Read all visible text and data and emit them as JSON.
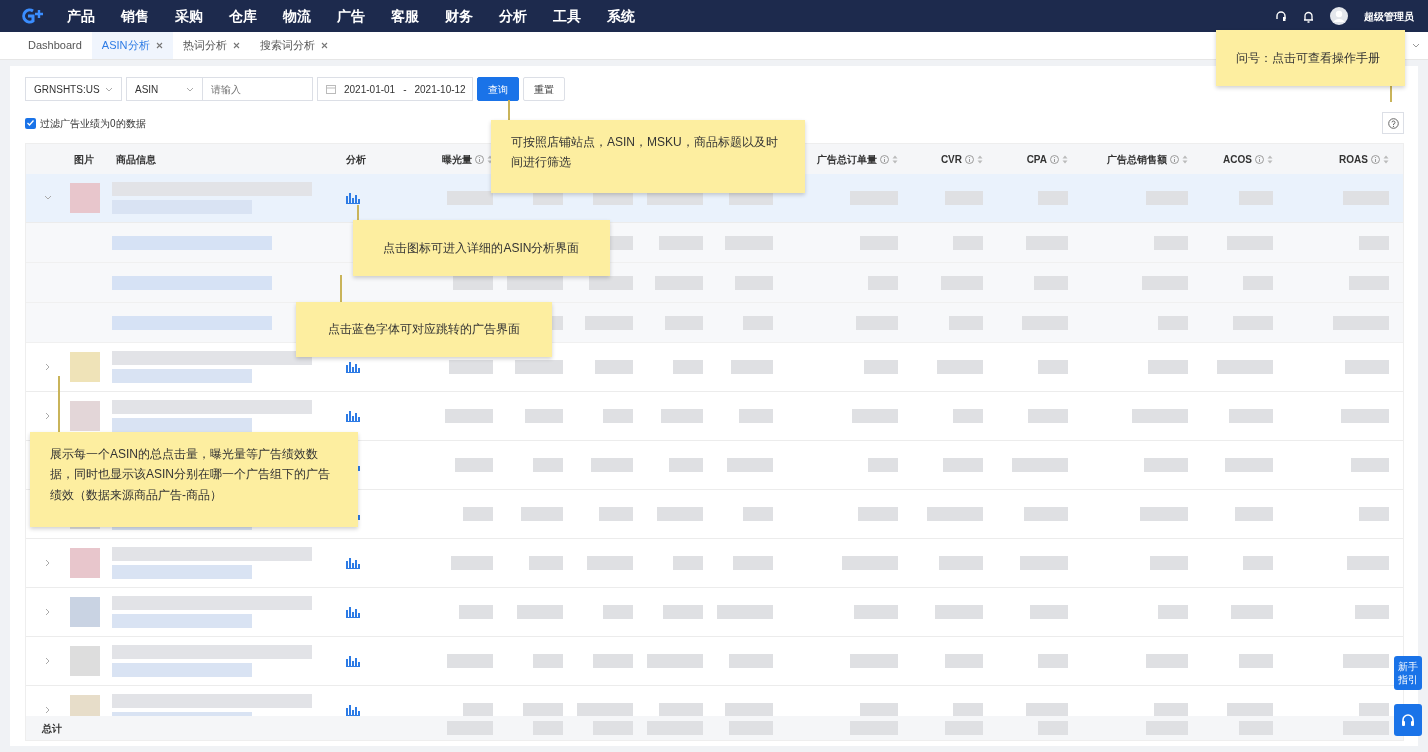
{
  "nav": {
    "items": [
      {
        "label": "产品",
        "selected": false
      },
      {
        "label": "销售",
        "selected": false
      },
      {
        "label": "采购",
        "selected": false
      },
      {
        "label": "仓库",
        "selected": false
      },
      {
        "label": "物流",
        "selected": false
      },
      {
        "label": "广告",
        "selected": false
      },
      {
        "label": "客服",
        "selected": false
      },
      {
        "label": "财务",
        "selected": false
      },
      {
        "label": "分析",
        "selected": false
      },
      {
        "label": "工具",
        "selected": false
      },
      {
        "label": "系统",
        "selected": false
      }
    ]
  },
  "user": {
    "name": "超级管理员"
  },
  "tabs": [
    {
      "label": "Dashboard",
      "selected": false,
      "closable": false
    },
    {
      "label": "ASIN分析",
      "selected": true,
      "closable": true
    },
    {
      "label": "热词分析",
      "selected": false,
      "closable": true
    },
    {
      "label": "搜索词分析",
      "selected": false,
      "closable": true
    }
  ],
  "filters": {
    "store": "GRNSHTS:US",
    "search_type": "ASIN",
    "search": {
      "placeholder": "请输入"
    },
    "date_start": "2021-01-01",
    "date_separator": "-",
    "date_end": "2021-10-12",
    "buttons": [
      {
        "label": "查询",
        "kind": "primary"
      },
      {
        "label": "重置",
        "kind": "default"
      }
    ],
    "filter_zero": {
      "label": "过滤广告业绩为0的数据",
      "checked": true
    }
  },
  "table": {
    "columns": [
      {
        "label": "图片",
        "sortable": false
      },
      {
        "label": "商品信息",
        "sortable": false
      },
      {
        "label": "分析",
        "sortable": false
      },
      {
        "label": "曝光量",
        "sortable": true
      },
      {
        "label": "广告总订单量",
        "sortable": true
      },
      {
        "label": "CVR",
        "sortable": true
      },
      {
        "label": "CPA",
        "sortable": true
      },
      {
        "label": "广告总销售额",
        "sortable": true
      },
      {
        "label": "ACOS",
        "sortable": true
      },
      {
        "label": "ROAS",
        "sortable": true
      }
    ],
    "rows": [
      {
        "kind": "product",
        "expanded": true
      },
      {
        "kind": "ad-group"
      },
      {
        "kind": "ad-group"
      },
      {
        "kind": "ad-group"
      },
      {
        "kind": "product",
        "expanded": false
      },
      {
        "kind": "product",
        "expanded": false
      },
      {
        "kind": "product"
      },
      {
        "kind": "product"
      },
      {
        "kind": "product",
        "expanded": false
      },
      {
        "kind": "product",
        "expanded": false
      },
      {
        "kind": "product",
        "expanded": false
      },
      {
        "kind": "product",
        "expanded": false
      }
    ],
    "total_label": "总计"
  },
  "side_buttons": {
    "guide": "新手指引"
  },
  "notes": [
    {
      "text": "问号：点击可查看操作手册"
    },
    {
      "text": "可按照店铺站点，ASIN，MSKU，商品标题以及时间进行筛选"
    },
    {
      "text": "点击图标可进入详细的ASIN分析界面"
    },
    {
      "text": "点击蓝色字体可对应跳转的广告界面"
    },
    {
      "text": "展示每一个ASIN的总点击量，曝光量等广告绩效数据，同时也显示该ASIN分别在哪一个广告组下的广告绩效（数据来源商品广告-商品）"
    }
  ]
}
